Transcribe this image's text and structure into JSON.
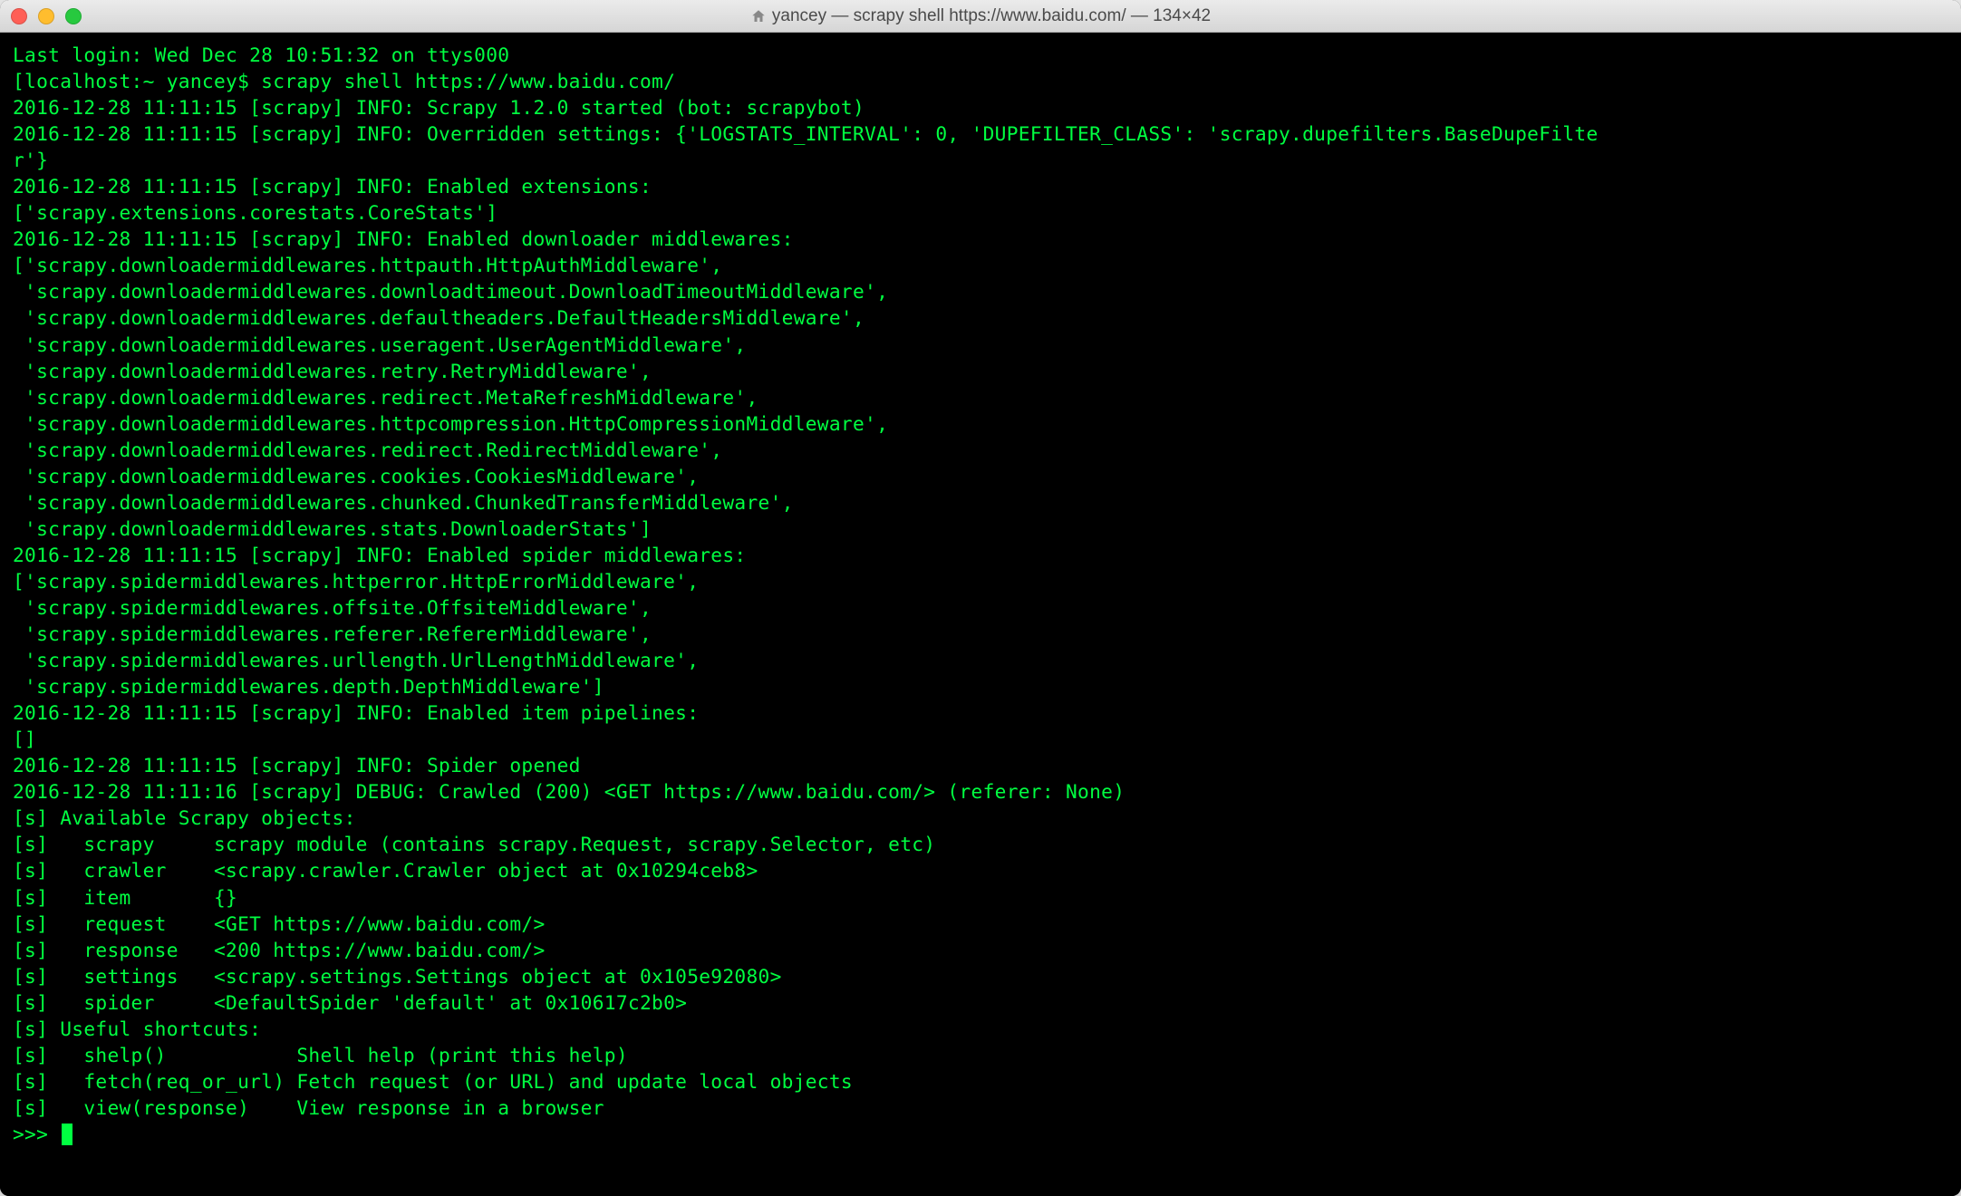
{
  "window": {
    "title": "yancey — scrapy shell https://www.baidu.com/ — 134×42"
  },
  "terminal": {
    "lines": [
      "Last login: Wed Dec 28 10:51:32 on ttys000",
      "[localhost:~ yancey$ scrapy shell https://www.baidu.com/",
      "2016-12-28 11:11:15 [scrapy] INFO: Scrapy 1.2.0 started (bot: scrapybot)",
      "2016-12-28 11:11:15 [scrapy] INFO: Overridden settings: {'LOGSTATS_INTERVAL': 0, 'DUPEFILTER_CLASS': 'scrapy.dupefilters.BaseDupeFilte",
      "r'}",
      "2016-12-28 11:11:15 [scrapy] INFO: Enabled extensions:",
      "['scrapy.extensions.corestats.CoreStats']",
      "2016-12-28 11:11:15 [scrapy] INFO: Enabled downloader middlewares:",
      "['scrapy.downloadermiddlewares.httpauth.HttpAuthMiddleware',",
      " 'scrapy.downloadermiddlewares.downloadtimeout.DownloadTimeoutMiddleware',",
      " 'scrapy.downloadermiddlewares.defaultheaders.DefaultHeadersMiddleware',",
      " 'scrapy.downloadermiddlewares.useragent.UserAgentMiddleware',",
      " 'scrapy.downloadermiddlewares.retry.RetryMiddleware',",
      " 'scrapy.downloadermiddlewares.redirect.MetaRefreshMiddleware',",
      " 'scrapy.downloadermiddlewares.httpcompression.HttpCompressionMiddleware',",
      " 'scrapy.downloadermiddlewares.redirect.RedirectMiddleware',",
      " 'scrapy.downloadermiddlewares.cookies.CookiesMiddleware',",
      " 'scrapy.downloadermiddlewares.chunked.ChunkedTransferMiddleware',",
      " 'scrapy.downloadermiddlewares.stats.DownloaderStats']",
      "2016-12-28 11:11:15 [scrapy] INFO: Enabled spider middlewares:",
      "['scrapy.spidermiddlewares.httperror.HttpErrorMiddleware',",
      " 'scrapy.spidermiddlewares.offsite.OffsiteMiddleware',",
      " 'scrapy.spidermiddlewares.referer.RefererMiddleware',",
      " 'scrapy.spidermiddlewares.urllength.UrlLengthMiddleware',",
      " 'scrapy.spidermiddlewares.depth.DepthMiddleware']",
      "2016-12-28 11:11:15 [scrapy] INFO: Enabled item pipelines:",
      "[]",
      "2016-12-28 11:11:15 [scrapy] INFO: Spider opened",
      "2016-12-28 11:11:16 [scrapy] DEBUG: Crawled (200) <GET https://www.baidu.com/> (referer: None)",
      "[s] Available Scrapy objects:",
      "[s]   scrapy     scrapy module (contains scrapy.Request, scrapy.Selector, etc)",
      "[s]   crawler    <scrapy.crawler.Crawler object at 0x10294ceb8>",
      "[s]   item       {}",
      "[s]   request    <GET https://www.baidu.com/>",
      "[s]   response   <200 https://www.baidu.com/>",
      "[s]   settings   <scrapy.settings.Settings object at 0x105e92080>",
      "[s]   spider     <DefaultSpider 'default' at 0x10617c2b0>",
      "[s] Useful shortcuts:",
      "[s]   shelp()           Shell help (print this help)",
      "[s]   fetch(req_or_url) Fetch request (or URL) and update local objects",
      "[s]   view(response)    View response in a browser"
    ],
    "prompt": ">>> "
  }
}
